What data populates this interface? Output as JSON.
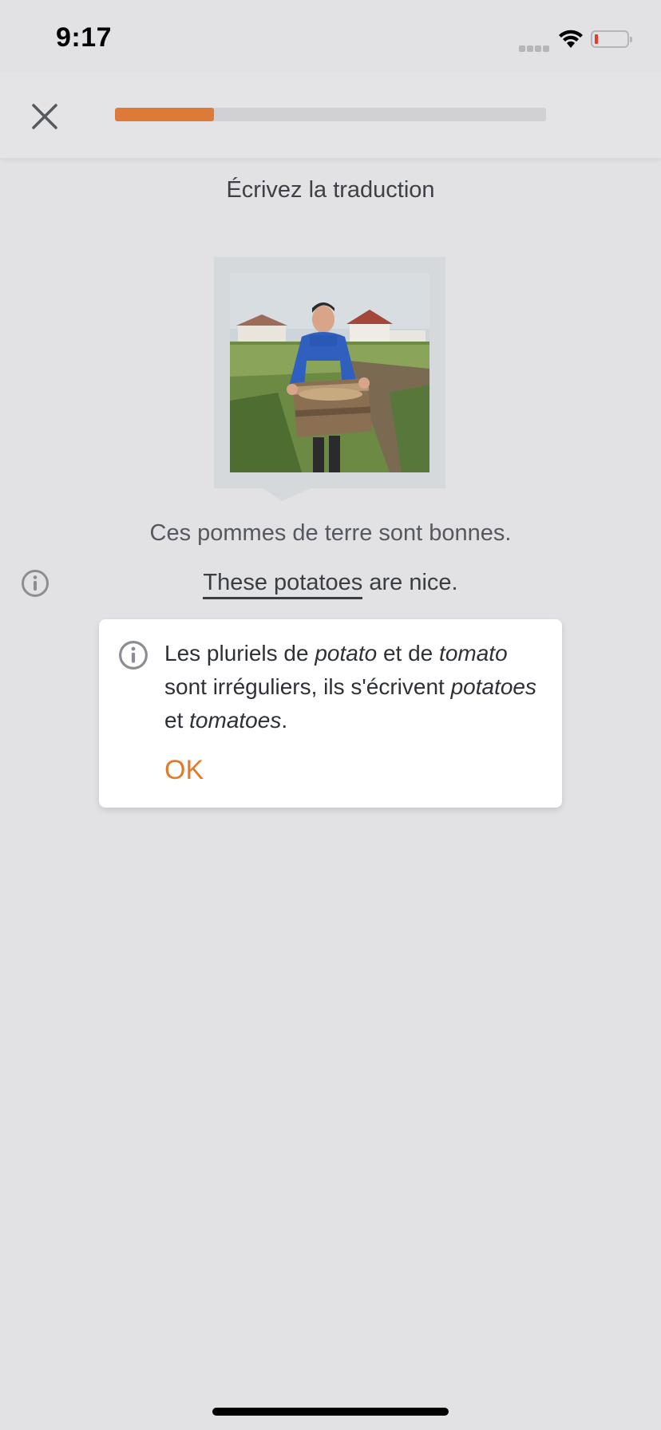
{
  "status_bar": {
    "time": "9:17",
    "icons": [
      "signal-icon",
      "wifi-icon",
      "battery-icon"
    ]
  },
  "header": {
    "close_icon": "close-icon",
    "progress_fraction": 0.23,
    "progress_color": "#dc7a37"
  },
  "exercise": {
    "instruction": "Écrivez la traduction",
    "french_sentence": "Ces pommes de terre sont bonnes.",
    "english_highlight": "These potatoes",
    "english_rest": " are nice."
  },
  "tip": {
    "icon": "info-icon",
    "line1_a": "Les pluriels de ",
    "word1": "potato",
    "line1_b": " et de ",
    "word2": "tomato",
    "line2": " sont irréguliers, ils s'écrivent ",
    "word3": "potatoes",
    "line3_b": " et ",
    "word4": "tomatoes",
    "line3_c": ".",
    "ok_label": "OK",
    "ok_color": "#e07a2e"
  }
}
